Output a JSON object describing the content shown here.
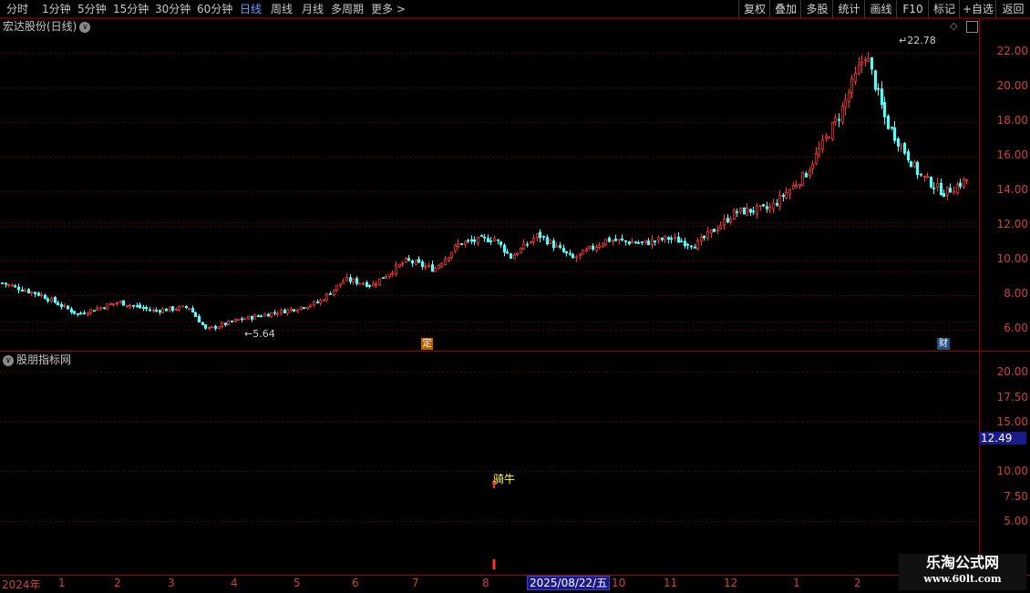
{
  "toolbar": {
    "timeframes": [
      "分时",
      "1分钟",
      "5分钟",
      "15分钟",
      "30分钟",
      "60分钟",
      "日线",
      "周线",
      "月线",
      "多周期",
      "更多"
    ],
    "active_timeframe": "日线",
    "buttons": [
      "复权",
      "叠加",
      "多股",
      "统计",
      "画线",
      "F10",
      "标记",
      "+自选",
      "返回"
    ]
  },
  "main_chart": {
    "title": "宏达股份(日线)",
    "high_marker": "22.78",
    "low_marker": "5.64",
    "event_tag_left": "定",
    "event_tag_right": "财",
    "y_ticks": [
      "22.00",
      "20.00",
      "18.00",
      "16.00",
      "14.00",
      "12.00",
      "10.00",
      "8.00",
      "6.00"
    ]
  },
  "indicator_panel": {
    "title": "股朋指标网",
    "y_ticks": [
      "20.00",
      "17.50",
      "15.00",
      "12.50",
      "10.00",
      "7.50",
      "5.00"
    ],
    "current_value": "12.49",
    "signal_label": "骑牛"
  },
  "date_axis": {
    "year_label": "2024年",
    "months": [
      "1",
      "2",
      "3",
      "4",
      "5",
      "6",
      "7",
      "8",
      "10",
      "11",
      "12",
      "1",
      "2"
    ],
    "cursor_date": "2025/08/22/五"
  },
  "watermark": {
    "title": "乐淘公式网",
    "url": "www.60lt.com"
  },
  "colors": {
    "up": "#ff3232",
    "down": "#54fcfc",
    "grid": "#5a0000",
    "axis": "#a00000",
    "active": "#5aa0ff"
  },
  "chart_data": {
    "type": "candlestick",
    "x_range": [
      "2024-01",
      "2025-02"
    ],
    "ylim": [
      5.0,
      23.0
    ],
    "keypoints": [
      {
        "date": "2024-01-02",
        "close": 8.7
      },
      {
        "date": "2024-01-25",
        "close": 8.0
      },
      {
        "date": "2024-02-15",
        "close": 6.9
      },
      {
        "date": "2024-03-10",
        "close": 7.6
      },
      {
        "date": "2024-03-30",
        "close": 7.1
      },
      {
        "date": "2024-04-20",
        "close": 7.3
      },
      {
        "date": "2024-04-30",
        "close": 6.0
      },
      {
        "date": "2024-05-20",
        "close": 6.6
      },
      {
        "date": "2024-06-20",
        "close": 7.2
      },
      {
        "date": "2024-07-05",
        "close": 7.6
      },
      {
        "date": "2024-07-20",
        "close": 8.9
      },
      {
        "date": "2024-08-05",
        "close": 8.6
      },
      {
        "date": "2024-08-25",
        "close": 10.0
      },
      {
        "date": "2024-09-10",
        "close": 9.5
      },
      {
        "date": "2024-09-25",
        "close": 11.0
      },
      {
        "date": "2024-10-15",
        "close": 11.3
      },
      {
        "date": "2024-10-25",
        "close": 10.2
      },
      {
        "date": "2024-11-10",
        "close": 11.5
      },
      {
        "date": "2024-11-30",
        "close": 10.1
      },
      {
        "date": "2024-12-20",
        "close": 11.2
      },
      {
        "date": "2025-01-10",
        "close": 11.0
      },
      {
        "date": "2025-01-25",
        "close": 11.3
      },
      {
        "date": "2025-02-10",
        "close": 10.9
      },
      {
        "date": "2025-03-05",
        "close": 12.8
      },
      {
        "date": "2025-03-25",
        "close": 13.0
      },
      {
        "date": "2025-04-15",
        "close": 15.0
      },
      {
        "date": "2025-05-05",
        "close": 18.5
      },
      {
        "date": "2025-05-20",
        "close": 22.0
      },
      {
        "date": "2025-06-01",
        "close": 18.0
      },
      {
        "date": "2025-06-20",
        "close": 15.0
      },
      {
        "date": "2025-07-05",
        "close": 13.9
      },
      {
        "date": "2025-07-20",
        "close": 14.8
      }
    ]
  }
}
